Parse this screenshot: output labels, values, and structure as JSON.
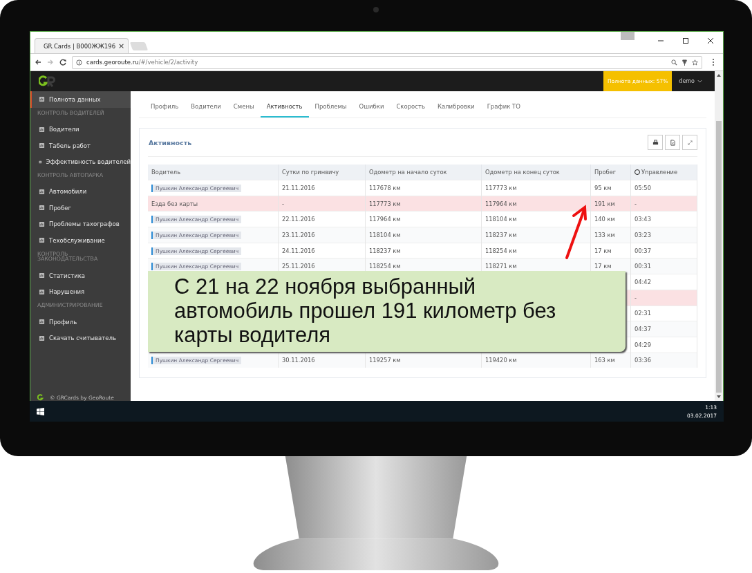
{
  "browser": {
    "tab_title": "GR.Cards | В000ЖЖ196",
    "tab_close": "×",
    "url_host": "cards.georoute.ru",
    "url_path": "/#/vehicle/2/activity"
  },
  "app": {
    "completeness": "Полнота данных: 57%",
    "user": "demo"
  },
  "sidebar": {
    "items": [
      {
        "kind": "item",
        "label": "Полнота данных",
        "selected": true
      },
      {
        "kind": "section",
        "label": "КОНТРОЛЬ ВОДИТЕЛЕЙ"
      },
      {
        "kind": "item",
        "label": "Водители",
        "selected": false
      },
      {
        "kind": "item",
        "label": "Табель работ",
        "selected": false
      },
      {
        "kind": "item",
        "label": "Эффективность водителей",
        "selected": false
      },
      {
        "kind": "section",
        "label": "КОНТРОЛЬ АВТОПАРКА"
      },
      {
        "kind": "item",
        "label": "Автомобили",
        "selected": false
      },
      {
        "kind": "item",
        "label": "Пробег",
        "selected": false
      },
      {
        "kind": "item",
        "label": "Проблемы тахографов",
        "selected": false
      },
      {
        "kind": "item",
        "label": "Техобслуживание",
        "selected": false
      },
      {
        "kind": "section",
        "label": "КОНТРОЛЬ ЗАКОНОДАТЕЛЬСТВА"
      },
      {
        "kind": "item",
        "label": "Статистика",
        "selected": false
      },
      {
        "kind": "item",
        "label": "Нарушения",
        "selected": false
      },
      {
        "kind": "section",
        "label": "АДМИНИСТРИРОВАНИЕ"
      },
      {
        "kind": "item",
        "label": "Профиль",
        "selected": false
      },
      {
        "kind": "item",
        "label": "Скачать считыватель",
        "selected": false
      }
    ],
    "footer": "© GRCards by GeoRoute"
  },
  "tabs": [
    {
      "label": "Профиль",
      "selected": false
    },
    {
      "label": "Водители",
      "selected": false
    },
    {
      "label": "Смены",
      "selected": false
    },
    {
      "label": "Активность",
      "selected": true
    },
    {
      "label": "Проблемы",
      "selected": false
    },
    {
      "label": "Ошибки",
      "selected": false
    },
    {
      "label": "Скорость",
      "selected": false
    },
    {
      "label": "Калибровки",
      "selected": false
    },
    {
      "label": "График ТО",
      "selected": false
    }
  ],
  "panel": {
    "title": "Активность"
  },
  "table": {
    "columns": [
      "Водитель",
      "Сутки по гринвичу",
      "Одометр на начало суток",
      "Одометр на конец суток",
      "Пробег",
      "Управление"
    ],
    "rows": [
      {
        "kind": "driver",
        "cells": [
          "Пушкин Александр Сергеевич",
          "21.11.2016",
          "117678 км",
          "117773 км",
          "95 км",
          "05:50"
        ]
      },
      {
        "kind": "no_card",
        "cells": [
          "Езда без карты",
          "-",
          "117773 км",
          "117964 км",
          "191 км",
          "-"
        ]
      },
      {
        "kind": "driver",
        "cells": [
          "Пушкин Александр Сергеевич",
          "22.11.2016",
          "117964 км",
          "118104 км",
          "140 км",
          "03:43"
        ]
      },
      {
        "kind": "driver",
        "cells": [
          "Пушкин Александр Сергеевич",
          "23.11.2016",
          "118104 км",
          "118237 км",
          "133 км",
          "03:23"
        ]
      },
      {
        "kind": "driver",
        "cells": [
          "Пушкин Александр Сергеевич",
          "24.11.2016",
          "118237 км",
          "118254 км",
          "17 км",
          "00:37"
        ]
      },
      {
        "kind": "driver",
        "cells": [
          "Пушкин Александр Сергеевич",
          "25.11.2016",
          "118254 км",
          "118271 км",
          "17 км",
          "00:31"
        ]
      },
      {
        "kind": "driver",
        "cells": [
          "04:42"
        ]
      },
      {
        "kind": "no_card",
        "cells": [
          "-"
        ]
      },
      {
        "kind": "driver",
        "cells": [
          "02:31"
        ]
      },
      {
        "kind": "driver",
        "cells": [
          "04:37"
        ]
      },
      {
        "kind": "driver",
        "cells": [
          "04:29"
        ]
      },
      {
        "kind": "driver",
        "cells": [
          "Пушкин Александр Сергеевич",
          "30.11.2016",
          "119257 км",
          "119420 км",
          "163 км",
          "03:36"
        ]
      }
    ]
  },
  "callout": {
    "text": "С 21 на 22 ноября выбранный автомобиль прошел 191 километр без карты водителя"
  },
  "taskbar": {
    "time": "1:13",
    "date": "03.02.2017"
  }
}
